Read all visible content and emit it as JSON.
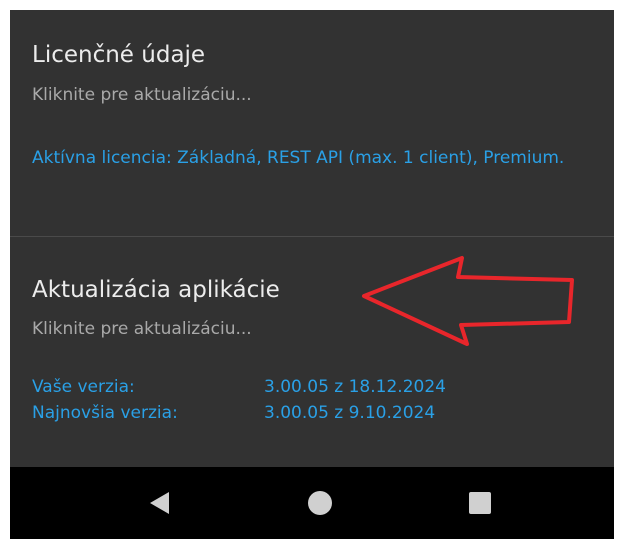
{
  "license": {
    "title": "Licenčné údaje",
    "subtitle": "Kliknite pre aktualizáciu...",
    "info": "Aktívna licencia: Základná, REST API (max. 1 client), Premium."
  },
  "update": {
    "title": "Aktualizácia aplikácie",
    "subtitle": "Kliknite pre aktualizáciu...",
    "rows": [
      {
        "label": "Vaše verzia:",
        "value": "3.00.05 z 18.12.2024"
      },
      {
        "label": "Najnovšia verzia:",
        "value": "3.00.05 z 9.10.2024"
      }
    ]
  },
  "annotation": {
    "arrow_color": "#e8262b",
    "direction": "left"
  },
  "navbar": {
    "back_icon": "back-triangle-icon",
    "home_icon": "home-circle-icon",
    "recents_icon": "recents-square-icon"
  },
  "colors": {
    "background": "#323232",
    "title": "#ececec",
    "subtitle": "#a9a9a9",
    "accent": "#2aa0e6",
    "navbar": "#000000"
  }
}
